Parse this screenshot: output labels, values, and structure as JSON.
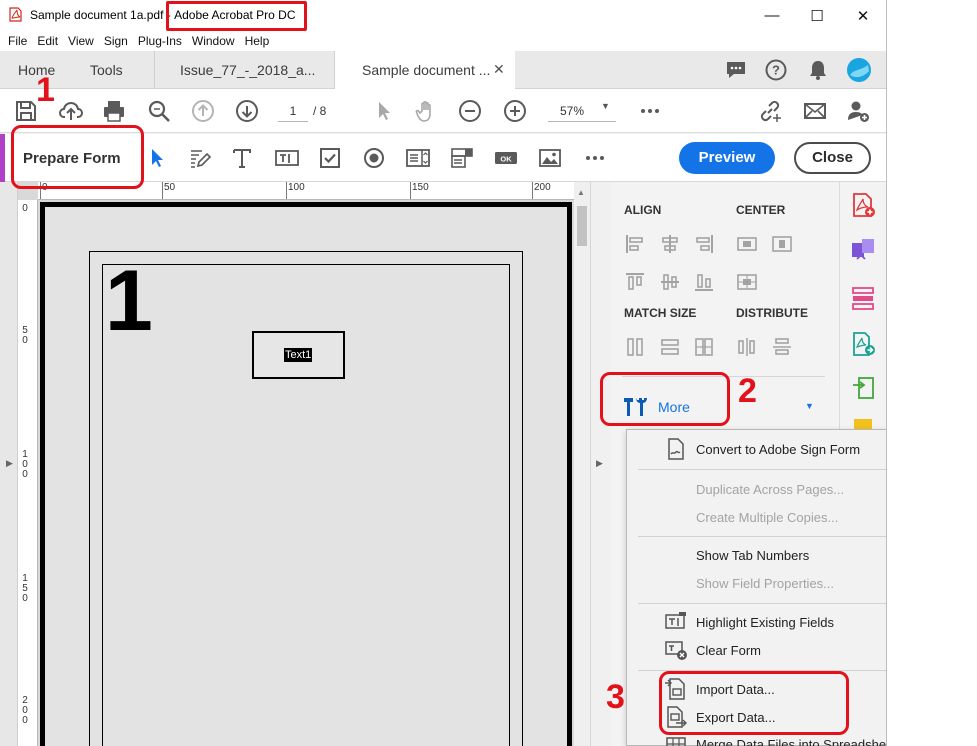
{
  "window": {
    "title_doc": "Sample document 1a.pdf",
    "title_sep": " - ",
    "title_app": "Adobe Acrobat Pro DC",
    "controls": [
      "—",
      "☐",
      "✕"
    ]
  },
  "menu": [
    "File",
    "Edit",
    "View",
    "Sign",
    "Plug-Ins",
    "Window",
    "Help"
  ],
  "tabs": {
    "home": "Home",
    "tools": "Tools",
    "doc1": "Issue_77_-_2018_a...",
    "doc2": "Sample document ..."
  },
  "toolbar": {
    "page_current": "1",
    "page_total": "/ 8",
    "zoom": "57%"
  },
  "prepare_form": {
    "label": "Prepare Form",
    "preview_label": "Preview",
    "close_label": "Close"
  },
  "ruler": {
    "top": [
      "0",
      "50",
      "100",
      "150",
      "200"
    ],
    "left": [
      [
        "0"
      ],
      [
        "5",
        "0"
      ],
      [
        "1",
        "0",
        "0"
      ],
      [
        "1",
        "5",
        "0"
      ],
      [
        "2",
        "0",
        "0"
      ]
    ]
  },
  "document": {
    "page_number": "1",
    "field_label": "Text1"
  },
  "right_pane": {
    "align": "ALIGN",
    "center": "CENTER",
    "match_size": "MATCH SIZE",
    "distribute": "DISTRIBUTE",
    "more": "More"
  },
  "context_menu": {
    "convert": "Convert to Adobe Sign Form",
    "duplicate": "Duplicate Across Pages...",
    "create_copies": "Create Multiple Copies...",
    "show_tab_numbers": "Show Tab Numbers",
    "show_field_properties": "Show Field Properties...",
    "highlight_fields": "Highlight Existing Fields",
    "clear_form": "Clear Form",
    "import_data": "Import Data...",
    "export_data": "Export Data...",
    "merge_files": "Merge Data Files into Spreadsheet..."
  },
  "annotations": {
    "step1": "1",
    "step2": "2",
    "step3": "3",
    "color": "#e2111a"
  },
  "colors": {
    "accent_blue": "#1473e6",
    "prepare_purple": "#b140c9",
    "annotation_red": "#e2111a"
  }
}
